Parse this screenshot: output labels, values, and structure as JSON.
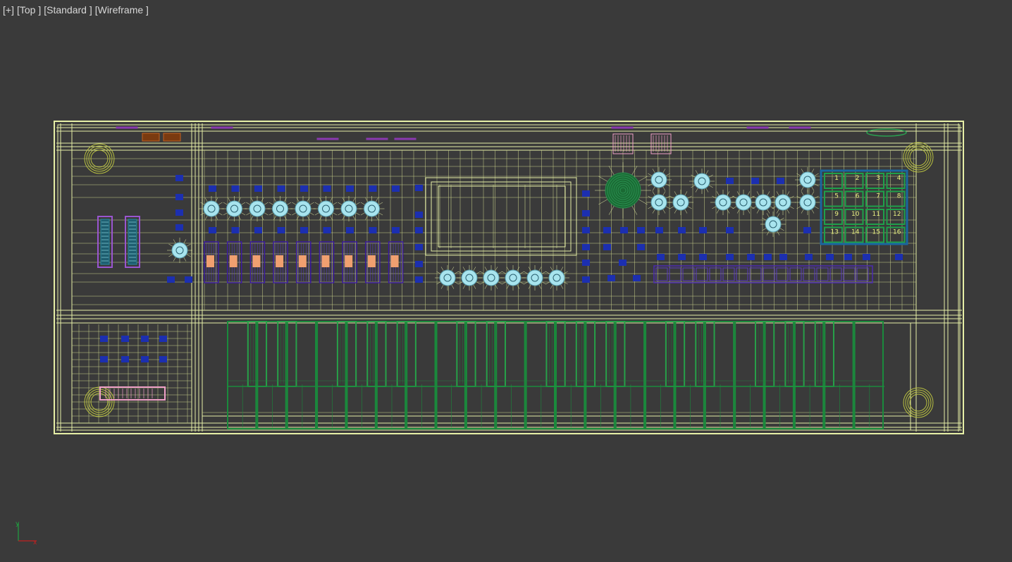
{
  "viewport": {
    "menu": [
      "[+]",
      "[Top ]",
      "[Standard ]",
      "[Wireframe ]"
    ]
  },
  "colors": {
    "background": "#3a3a3a",
    "wire": "#e6efa6",
    "wire_dim": "#c9d28a",
    "button_blue": "#1c2fb0",
    "knob_cyan": "#a8e4ee",
    "key_green": "#1a8a3c",
    "pad_green": "#1fa04a",
    "pad_frame": "#1a66a0",
    "slider_purple": "#3b1aa0",
    "slider_cap": "#f0a070",
    "side_bank": "#9a55d0",
    "pink": "#f0a0c8",
    "orange": "#c06020",
    "axis_x": "#c02020",
    "axis_y": "#20a040"
  },
  "pads": {
    "labels": [
      "1",
      "2",
      "3",
      "4",
      "5",
      "6",
      "7",
      "8",
      "9",
      "10",
      "11",
      "12",
      "13",
      "14",
      "15",
      "16"
    ]
  },
  "axis": {
    "x": "x",
    "y": "y"
  },
  "icons": {
    "axis_gizmo": "axis-tripod-icon"
  }
}
